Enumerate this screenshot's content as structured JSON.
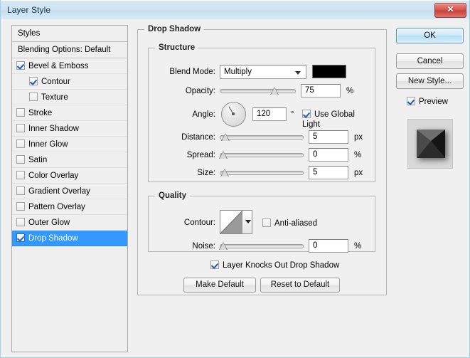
{
  "window": {
    "title": "Layer Style",
    "close_label": "✕"
  },
  "styles_panel": {
    "header": "Styles",
    "blending_options": "Blending Options: Default",
    "effects": [
      {
        "label": "Bevel & Emboss",
        "checked": true,
        "indent": false,
        "selected": false
      },
      {
        "label": "Contour",
        "checked": true,
        "indent": true,
        "selected": false
      },
      {
        "label": "Texture",
        "checked": false,
        "indent": true,
        "selected": false
      },
      {
        "label": "Stroke",
        "checked": false,
        "indent": false,
        "selected": false
      },
      {
        "label": "Inner Shadow",
        "checked": false,
        "indent": false,
        "selected": false
      },
      {
        "label": "Inner Glow",
        "checked": false,
        "indent": false,
        "selected": false
      },
      {
        "label": "Satin",
        "checked": false,
        "indent": false,
        "selected": false
      },
      {
        "label": "Color Overlay",
        "checked": false,
        "indent": false,
        "selected": false
      },
      {
        "label": "Gradient Overlay",
        "checked": false,
        "indent": false,
        "selected": false
      },
      {
        "label": "Pattern Overlay",
        "checked": false,
        "indent": false,
        "selected": false
      },
      {
        "label": "Outer Glow",
        "checked": false,
        "indent": false,
        "selected": false
      },
      {
        "label": "Drop Shadow",
        "checked": true,
        "indent": false,
        "selected": true
      }
    ]
  },
  "drop_shadow": {
    "group_title": "Drop Shadow",
    "structure": {
      "group_title": "Structure",
      "blend_mode_label": "Blend Mode:",
      "blend_mode_value": "Multiply",
      "blend_color": "#000000",
      "opacity_label": "Opacity:",
      "opacity_value": "75",
      "opacity_unit": "%",
      "opacity_percent": 75,
      "angle_label": "Angle:",
      "angle_value": "120",
      "angle_unit": "°",
      "angle_degrees": 120,
      "use_global_light_label": "Use Global Light",
      "use_global_light_checked": true,
      "distance_label": "Distance:",
      "distance_value": "5",
      "distance_unit": "px",
      "distance_percent": 3,
      "spread_label": "Spread:",
      "spread_value": "0",
      "spread_unit": "%",
      "spread_percent": 0,
      "size_label": "Size:",
      "size_value": "5",
      "size_unit": "px",
      "size_percent": 2
    },
    "quality": {
      "group_title": "Quality",
      "contour_label": "Contour:",
      "anti_aliased_label": "Anti-aliased",
      "anti_aliased_checked": false,
      "noise_label": "Noise:",
      "noise_value": "0",
      "noise_unit": "%",
      "noise_percent": 0
    },
    "knockout_label": "Layer Knocks Out Drop Shadow",
    "knockout_checked": true,
    "make_default_label": "Make Default",
    "reset_default_label": "Reset to Default"
  },
  "actions": {
    "ok_label": "OK",
    "cancel_label": "Cancel",
    "new_style_label": "New Style...",
    "preview_label": "Preview",
    "preview_checked": true
  },
  "colors": {
    "selection_blue": "#3399ff",
    "titlebar_blue": "#cfe3f3",
    "close_red": "#d9534c"
  }
}
